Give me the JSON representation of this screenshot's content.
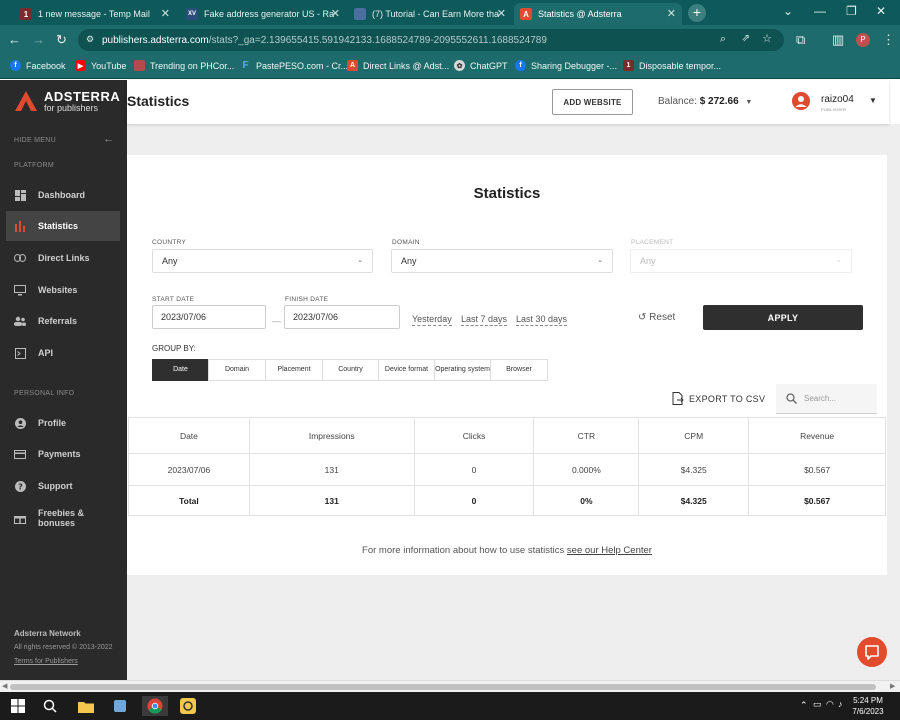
{
  "browser": {
    "tabs": [
      {
        "title": "1 new message - Temp Mail",
        "favicon": "1"
      },
      {
        "title": "Fake address generator US - Ra",
        "favicon": "XV"
      },
      {
        "title": "(7) Tutorial - Can Earn More tha",
        "favicon": "shield"
      },
      {
        "title": "Statistics @ Adsterra",
        "favicon": "A"
      }
    ],
    "url_host": "publishers.adsterra.com",
    "url_path": "/stats?_ga=2.139655415.591942133.1688524789-2095552611.1688524789",
    "profile_initial": "P",
    "bookmarks": [
      "Facebook",
      "YouTube",
      "Trending on PHCor...",
      "PastePESO.com - Cr...",
      "Direct Links @ Adst...",
      "ChatGPT",
      "Sharing Debugger -...",
      "Disposable tempor..."
    ]
  },
  "sidebar": {
    "brand": "ADSTERRA",
    "brand_sub": "for publishers",
    "hide_menu": "HIDE MENU",
    "section_platform": "PLATFORM",
    "items": [
      {
        "label": "Dashboard",
        "icon": "dashboard-icon"
      },
      {
        "label": "Statistics",
        "icon": "bar-chart-icon"
      },
      {
        "label": "Direct Links",
        "icon": "link-icon"
      },
      {
        "label": "Websites",
        "icon": "monitor-icon"
      },
      {
        "label": "Referrals",
        "icon": "people-icon"
      },
      {
        "label": "API",
        "icon": "terminal-icon"
      }
    ],
    "section_personal": "PERSONAL INFO",
    "personal_items": [
      {
        "label": "Profile",
        "icon": "user-icon"
      },
      {
        "label": "Payments",
        "icon": "card-icon"
      },
      {
        "label": "Support",
        "icon": "help-icon"
      },
      {
        "label": "Freebies & bonuses",
        "icon": "gift-icon"
      }
    ],
    "footer_company": "Adsterra Network",
    "footer_rights": "All rights reserved © 2013-2022",
    "footer_terms": "Terms for Publishers"
  },
  "header": {
    "title": "Statistics",
    "add_website": "ADD WEBSITE",
    "balance_label": "Balance:",
    "balance_value": "$ 272.66",
    "username": "raizo04",
    "role": "PUBLISHER"
  },
  "filters": {
    "heading": "Statistics",
    "country_label": "COUNTRY",
    "country_value": "Any",
    "domain_label": "DOMAIN",
    "domain_value": "Any",
    "placement_label": "PLACEMENT",
    "placement_value": "Any",
    "start_label": "START DATE",
    "start_value": "2023/07/06",
    "finish_label": "FINISH DATE",
    "finish_value": "2023/07/06",
    "dash": "—",
    "quick": [
      "Yesterday",
      "Last 7 days",
      "Last 30 days"
    ],
    "reset": "Reset",
    "apply": "APPLY",
    "group_by_label": "GROUP BY:",
    "group_by": [
      "Date",
      "Domain",
      "Placement",
      "Country",
      "Device format",
      "Operating system",
      "Browser"
    ],
    "export": "EXPORT TO CSV",
    "search_placeholder": "Search..."
  },
  "table": {
    "headers": [
      "Date",
      "Impressions",
      "Clicks",
      "CTR",
      "CPM",
      "Revenue"
    ],
    "rows": [
      [
        "2023/07/06",
        "131",
        "0",
        "0.000%",
        "$4.325",
        "$0.567"
      ]
    ],
    "total": [
      "Total",
      "131",
      "0",
      "0%",
      "$4.325",
      "$0.567"
    ]
  },
  "help": {
    "text": "For more information about how to use statistics ",
    "link": "see our Help Center"
  },
  "taskbar": {
    "time": "5:24 PM",
    "date": "7/6/2023"
  },
  "colors": {
    "brand": "#e04a2f",
    "chrome": "#1d6b6b",
    "sidebar": "#2a2a2a",
    "apply": "#2f2f2f"
  }
}
